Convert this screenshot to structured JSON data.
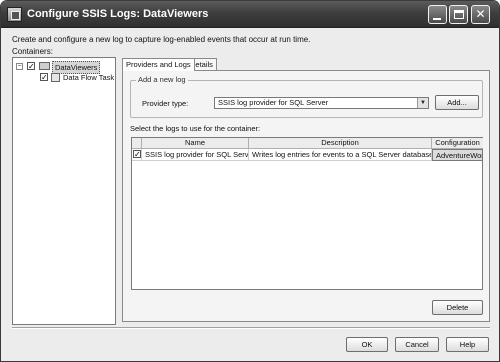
{
  "window": {
    "title": "Configure SSIS Logs: DataViewers"
  },
  "description": "Create and configure a new log to capture log-enabled events that occur at run time.",
  "containers_label": "Containers:",
  "tree": {
    "root": {
      "label": "DataViewers",
      "checked": true,
      "expander": "⊟"
    },
    "child": {
      "label": "Data Flow Task",
      "checked": true
    }
  },
  "tabs": [
    {
      "label": "Providers and Logs",
      "active": true
    },
    {
      "label": "Details",
      "active": false
    }
  ],
  "add_log": {
    "legend": "Add a new log",
    "provider_type_label": "Provider type:",
    "provider_type_value": "SSIS log provider for SQL Server",
    "add_button": "Add..."
  },
  "logs": {
    "label": "Select the logs to use for the container:",
    "columns": [
      "Name",
      "Description",
      "Configuration"
    ],
    "rows": [
      {
        "checked": true,
        "name": "SSIS log provider for SQL Server",
        "description": "Writes log entries for events to a SQL Server database",
        "configuration": "AdventureWorks"
      }
    ]
  },
  "buttons": {
    "delete": "Delete",
    "ok": "OK",
    "cancel": "Cancel",
    "help": "Help"
  },
  "glyphs": {
    "check": "✓",
    "dropdown": "▼"
  }
}
